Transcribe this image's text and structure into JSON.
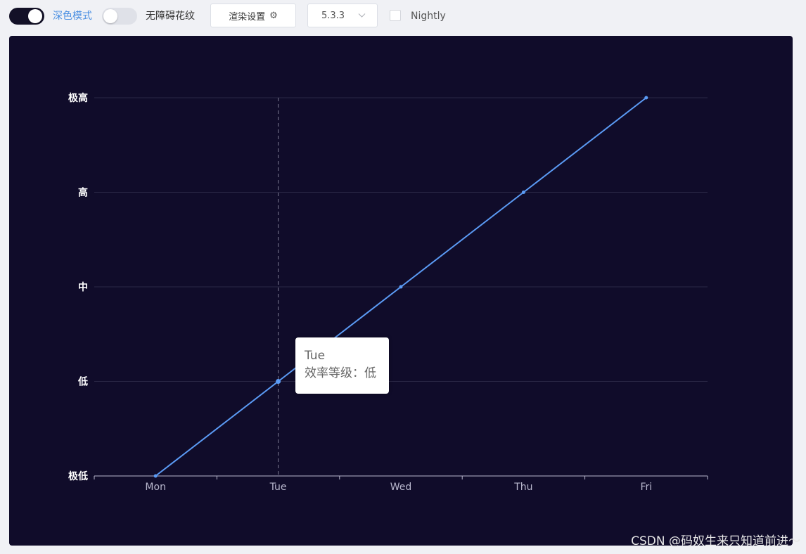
{
  "toolbar": {
    "dark_mode_label": "深色模式",
    "aria_pattern_label": "无障碍花纹",
    "render_settings_label": "渲染设置",
    "version_value": "5.3.3",
    "nightly_label": "Nightly"
  },
  "chart_data": {
    "type": "line",
    "categories": [
      "Mon",
      "Tue",
      "Wed",
      "Thu",
      "Fri"
    ],
    "y_categories": [
      "极低",
      "低",
      "中",
      "高",
      "极高"
    ],
    "values": [
      "极低",
      "低",
      "中",
      "高",
      "极高"
    ],
    "color": "#5b9bf5",
    "grid": true
  },
  "tooltip": {
    "title": "Tue",
    "line": "效率等级：低"
  },
  "watermark": "CSDN @码奴生来只知道前进～"
}
